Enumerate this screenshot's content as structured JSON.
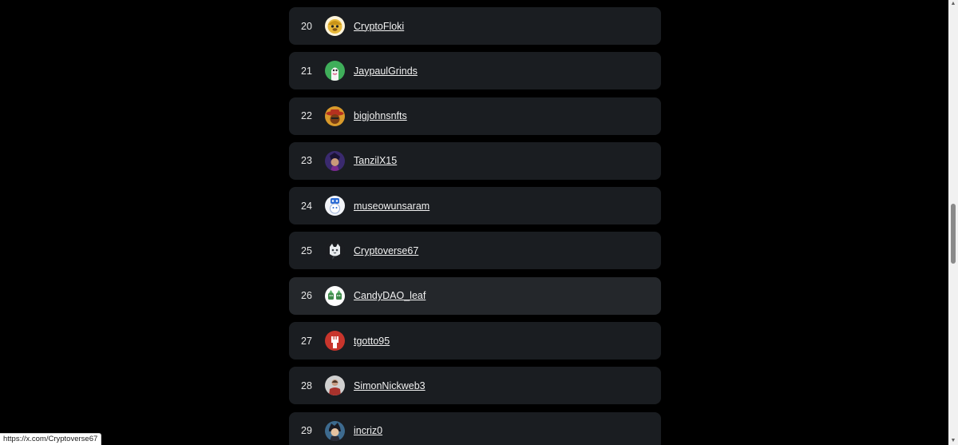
{
  "leaderboard": {
    "rows": [
      {
        "rank": "20",
        "name": "CryptoFloki",
        "avatar_icon": "doge-helmet-avatar-icon",
        "avatar_bg": "#e8b93a"
      },
      {
        "rank": "21",
        "name": "JaypaulGrinds",
        "avatar_icon": "green-character-avatar-icon",
        "avatar_bg": "#3fae5a"
      },
      {
        "rank": "22",
        "name": "bigjohnsnfts",
        "avatar_icon": "cowboy-avatar-icon",
        "avatar_bg": "#d99a2b"
      },
      {
        "rank": "23",
        "name": "TanzilX15",
        "avatar_icon": "purple-character-avatar-icon",
        "avatar_bg": "#3a2a6e"
      },
      {
        "rank": "24",
        "name": "museowunsaram",
        "avatar_icon": "white-robot-avatar-icon",
        "avatar_bg": "#f2f4f8"
      },
      {
        "rank": "25",
        "name": "Cryptoverse67",
        "avatar_icon": "cat-avatar-icon",
        "avatar_bg": "#1b1d21"
      },
      {
        "rank": "26",
        "name": "CandyDAO_leaf",
        "avatar_icon": "leaf-characters-avatar-icon",
        "avatar_bg": "#ffffff"
      },
      {
        "rank": "27",
        "name": "tgotto95",
        "avatar_icon": "fist-avatar-icon",
        "avatar_bg": "#c8352c"
      },
      {
        "rank": "28",
        "name": "SimonNickweb3",
        "avatar_icon": "person-photo-avatar-icon",
        "avatar_bg": "#d0d0d0"
      },
      {
        "rank": "29",
        "name": "incriz0",
        "avatar_icon": "anime-character-avatar-icon",
        "avatar_bg": "#3d6a8e"
      }
    ],
    "highlighted_rank": "26"
  },
  "status_bar": {
    "url": "https://x.com/Cryptoverse67"
  },
  "scrollbar": {
    "position_fraction": 0.52
  }
}
